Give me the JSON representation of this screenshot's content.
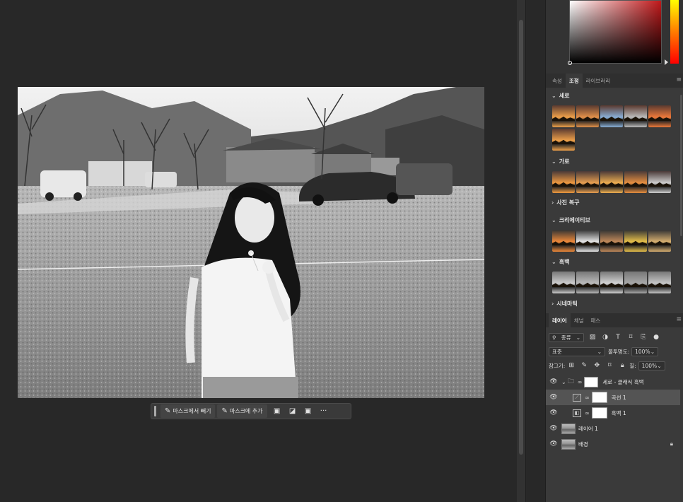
{
  "taskbar": {
    "subtract_mask_label": "마스크에서 빼기",
    "add_mask_label": "마스크에 추가",
    "more_label": "···"
  },
  "adjustments_panel": {
    "tabs": [
      "속성",
      "조정",
      "라이브러리"
    ],
    "active_tab": "조정",
    "sections": [
      {
        "title": "세로",
        "expanded": true,
        "thumbs": 6
      },
      {
        "title": "가로",
        "expanded": true,
        "thumbs": 5
      },
      {
        "title": "사진 복구",
        "expanded": false,
        "thumbs": 0
      },
      {
        "title": "크리에이티브",
        "expanded": true,
        "thumbs": 5
      },
      {
        "title": "흑백",
        "expanded": true,
        "thumbs": 5
      },
      {
        "title": "시네마틱",
        "expanded": false,
        "thumbs": 0
      }
    ]
  },
  "layers_panel": {
    "tabs": [
      "레이어",
      "채널",
      "패스"
    ],
    "active_tab": "레이어",
    "filter_kind": "종류",
    "blend_mode": "표준",
    "opacity_label": "불투명도:",
    "opacity_value": "100%",
    "lock_label": "잠그기:",
    "fill_label": "칠:",
    "fill_value": "100%",
    "layers": [
      {
        "name": "세로 - 클래식 흑백",
        "type": "group"
      },
      {
        "name": "곡선 1",
        "type": "curves",
        "selected": true
      },
      {
        "name": "흑백 1",
        "type": "blackwhite"
      },
      {
        "name": "레이어 1",
        "type": "pixel"
      },
      {
        "name": "배경",
        "type": "background",
        "locked": true
      }
    ]
  },
  "colors": {
    "bg": "#282828",
    "panel": "#3a3a3a",
    "selected_row": "#545454"
  }
}
